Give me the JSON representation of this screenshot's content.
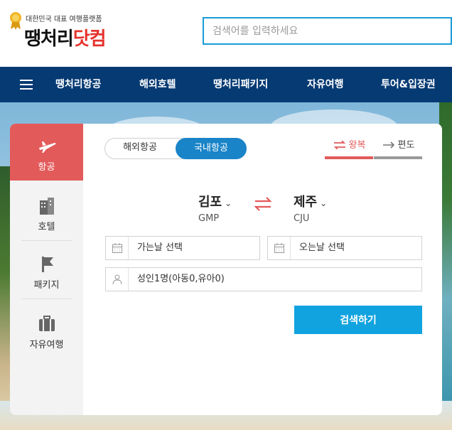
{
  "header": {
    "tagline": "대한민국 대표 여행플랫폼",
    "logo_part1": "땡처리",
    "logo_part2": "닷컴",
    "search_placeholder": "검색어를 입력하세요"
  },
  "nav": {
    "items": [
      "땡처리항공",
      "해외호텔",
      "땡처리패키지",
      "자유여행",
      "투어&입장권"
    ]
  },
  "sidebar": {
    "items": [
      {
        "label": "항공",
        "icon": "airplane-icon",
        "active": true
      },
      {
        "label": "호텔",
        "icon": "hotel-building-icon",
        "active": false
      },
      {
        "label": "패키지",
        "icon": "flag-icon",
        "active": false
      },
      {
        "label": "자유여행",
        "icon": "suitcase-icon",
        "active": false
      }
    ]
  },
  "flight": {
    "region_tabs": [
      "해외항공",
      "국내항공"
    ],
    "region_selected": "국내항공",
    "trip_tabs": [
      "왕복",
      "편도"
    ],
    "trip_selected": "왕복",
    "origin": {
      "name": "김포",
      "code": "GMP"
    },
    "destination": {
      "name": "제주",
      "code": "CJU"
    },
    "depart_label": "가는날 선택",
    "return_label": "오는날 선택",
    "passengers_label": "성인1명(아동0,유아0)",
    "search_button": "검색하기"
  },
  "colors": {
    "brand_navy": "#063a73",
    "accent_blue": "#1a84c8",
    "search_blue": "#10a3e0",
    "accent_red": "#e35a5a"
  }
}
